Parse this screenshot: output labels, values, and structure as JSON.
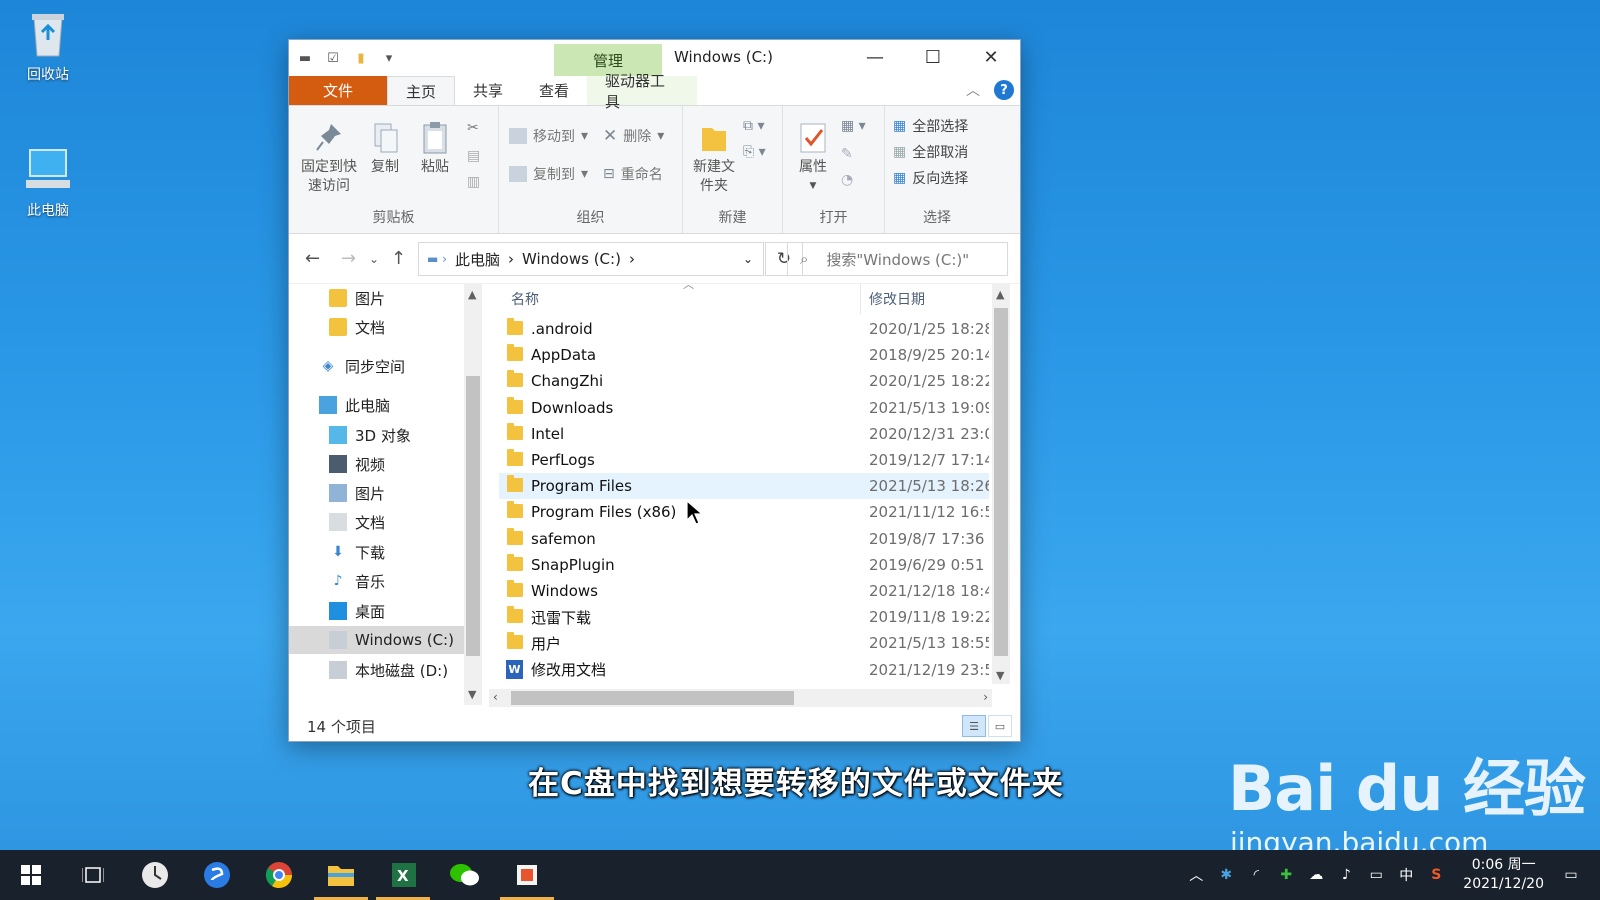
{
  "desktop": {
    "icons": [
      {
        "label": "回收站",
        "icon": "recycle-bin-icon"
      },
      {
        "label": "此电脑",
        "icon": "this-pc-icon"
      }
    ]
  },
  "window": {
    "title": "Windows (C:)",
    "context_tab": "管理",
    "ribbon_tabs": {
      "file": "文件",
      "home": "主页",
      "share": "共享",
      "view": "查看",
      "drive_tools": "驱动器工具"
    },
    "ribbon": {
      "clipboard": {
        "label": "剪贴板",
        "pin": "固定到快速访问",
        "copy": "复制",
        "paste": "粘贴"
      },
      "organize": {
        "label": "组织",
        "move_to": "移动到",
        "copy_to": "复制到",
        "delete": "删除",
        "rename": "重命名"
      },
      "new": {
        "label": "新建",
        "new_folder": "新建文件夹"
      },
      "open": {
        "label": "打开",
        "properties": "属性"
      },
      "select": {
        "label": "选择",
        "select_all": "全部选择",
        "select_none": "全部取消",
        "invert": "反向选择"
      }
    },
    "address": {
      "parts": [
        "此电脑",
        "Windows (C:)"
      ]
    },
    "search_placeholder": "搜索\"Windows (C:)\"",
    "nav_pane": [
      {
        "label": "图片",
        "icon": "folder-icon"
      },
      {
        "label": "文档",
        "icon": "folder-icon"
      },
      {
        "label": "同步空间",
        "icon": "sync-space-icon"
      },
      {
        "label": "此电脑",
        "icon": "this-pc-icon"
      },
      {
        "label": "3D 对象",
        "icon": "3d-objects-icon"
      },
      {
        "label": "视频",
        "icon": "videos-icon"
      },
      {
        "label": "图片",
        "icon": "pictures-icon"
      },
      {
        "label": "文档",
        "icon": "documents-icon"
      },
      {
        "label": "下载",
        "icon": "downloads-icon"
      },
      {
        "label": "音乐",
        "icon": "music-icon"
      },
      {
        "label": "桌面",
        "icon": "desktop-icon"
      },
      {
        "label": "Windows (C:)",
        "icon": "drive-c-icon"
      },
      {
        "label": "本地磁盘 (D:)",
        "icon": "drive-d-icon"
      }
    ],
    "columns": {
      "name": "名称",
      "modified": "修改日期"
    },
    "files": [
      {
        "name": ".android",
        "date": "2020/1/25 18:28",
        "type": "folder"
      },
      {
        "name": "AppData",
        "date": "2018/9/25 20:14",
        "type": "folder"
      },
      {
        "name": "ChangZhi",
        "date": "2020/1/25 18:22",
        "type": "folder"
      },
      {
        "name": "Downloads",
        "date": "2021/5/13 19:09",
        "type": "folder"
      },
      {
        "name": "Intel",
        "date": "2020/12/31 23:0",
        "type": "folder"
      },
      {
        "name": "PerfLogs",
        "date": "2019/12/7 17:14",
        "type": "folder"
      },
      {
        "name": "Program Files",
        "date": "2021/5/13 18:26",
        "type": "folder"
      },
      {
        "name": "Program Files (x86)",
        "date": "2021/11/12 16:5",
        "type": "folder"
      },
      {
        "name": "safemon",
        "date": "2019/8/7 17:36",
        "type": "folder"
      },
      {
        "name": "SnapPlugin",
        "date": "2019/6/29 0:51",
        "type": "folder"
      },
      {
        "name": "Windows",
        "date": "2021/12/18 18:4",
        "type": "folder"
      },
      {
        "name": "迅雷下载",
        "date": "2019/11/8 19:22",
        "type": "folder"
      },
      {
        "name": "用户",
        "date": "2021/5/13 18:55",
        "type": "folder"
      },
      {
        "name": "修改用文档",
        "date": "2021/12/19 23:5",
        "type": "word-doc"
      }
    ],
    "status": "14 个项目"
  },
  "subtitle": "在C盘中找到想要转移的文件或文件夹",
  "watermark": {
    "brand": "Bai du 经验",
    "url": "jingyan.baidu.com"
  },
  "taskbar": {
    "apps": [
      "start-icon",
      "task-view-icon",
      "clock-app-icon",
      "sogou-browser-icon",
      "chrome-icon",
      "file-explorer-icon",
      "excel-icon",
      "wechat-icon",
      "office-icon"
    ],
    "tray_ime": "中",
    "time": "0:06 周一",
    "date": "2021/12/20"
  },
  "colors": {
    "file_tab": "#d35c11",
    "context_tab": "#cbe8b4",
    "hover_row": "#e5f3ff",
    "taskbar": "#19212c"
  }
}
